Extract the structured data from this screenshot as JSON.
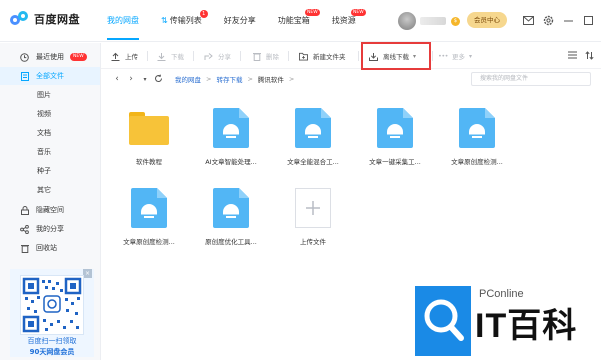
{
  "app": {
    "name": "百度网盘"
  },
  "nav": {
    "items": [
      {
        "label": "我的网盘"
      },
      {
        "label": "传输列表",
        "badge": "1"
      },
      {
        "label": "好友分享"
      },
      {
        "label": "功能宝箱",
        "badge": "NEW"
      },
      {
        "label": "找资源",
        "badge": "NEW"
      }
    ]
  },
  "user": {
    "vip_badge": "$",
    "member_button": "会员中心"
  },
  "sidebar": {
    "items": [
      {
        "label": "最近使用",
        "badge": "NEW"
      },
      {
        "label": "全部文件"
      },
      {
        "label": "图片"
      },
      {
        "label": "视频"
      },
      {
        "label": "文档"
      },
      {
        "label": "音乐"
      },
      {
        "label": "种子"
      },
      {
        "label": "其它"
      },
      {
        "label": "隐藏空间"
      },
      {
        "label": "我的分享"
      },
      {
        "label": "回收站"
      }
    ],
    "promo": {
      "line1": "百度扫一扫领取",
      "line2": "90天网盘会员"
    }
  },
  "toolbar": {
    "upload": "上传",
    "download": "下载",
    "share": "分享",
    "delete": "删除",
    "new_folder": "新建文件夹",
    "offline_download": "离线下载",
    "more": "更多"
  },
  "address": {
    "breadcrumbs": [
      "我的网盘",
      "转存下载",
      "腾讯软件"
    ],
    "search_placeholder": "搜索我的网盘文件"
  },
  "files": [
    {
      "name": "软件教程",
      "type": "folder"
    },
    {
      "name": "AI文章智能处理...",
      "type": "file"
    },
    {
      "name": "文章全能混合工...",
      "type": "file"
    },
    {
      "name": "文章一键采集工...",
      "type": "file"
    },
    {
      "name": "文章原创度检测...",
      "type": "file"
    },
    {
      "name": "文章原创度检测...",
      "type": "file"
    },
    {
      "name": "原创度优化工具...",
      "type": "file"
    },
    {
      "name": "上传文件",
      "type": "upload"
    }
  ],
  "watermark": {
    "site": "PConline",
    "brand": "IT百科"
  },
  "colors": {
    "accent": "#06a7ff",
    "file_icon": "#52b6f5",
    "folder": "#f7c339",
    "highlight_box": "#e63b3b"
  }
}
